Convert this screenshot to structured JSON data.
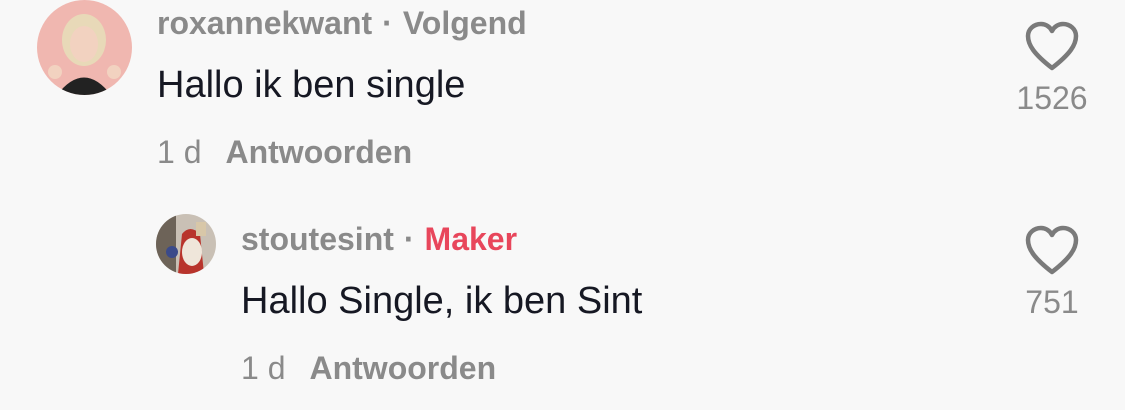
{
  "comments": [
    {
      "username": "roxannekwant",
      "separator": "·",
      "tag": "Volgend",
      "text": "Hallo ik ben single",
      "time": "1 d",
      "reply_label": "Antwoorden",
      "likes": "1526",
      "avatar_icon": "user-avatar"
    },
    {
      "username": "stoutesint",
      "separator": "·",
      "tag": "Maker",
      "tag_color": "#e8465b",
      "text": "Hallo Single, ik ben Sint",
      "time": "1 d",
      "reply_label": "Antwoorden",
      "likes": "751",
      "avatar_icon": "user-avatar"
    }
  ],
  "icons": {
    "like": "heart-outline-icon"
  },
  "colors": {
    "background": "#f8f8f8",
    "text_primary": "#161823",
    "text_secondary": "#8a8a8a",
    "maker_accent": "#e8465b"
  }
}
